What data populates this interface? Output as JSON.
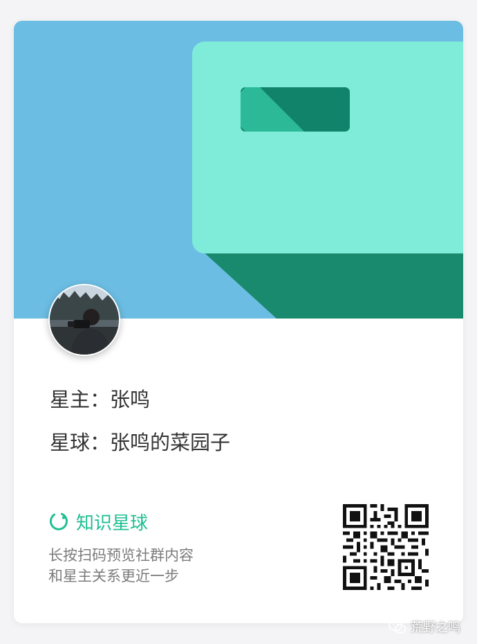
{
  "card": {
    "owner_label": "星主：",
    "owner_name": "张鸣",
    "planet_label": "星球：",
    "planet_name": "张鸣的菜园子",
    "brand_name": "知识星球",
    "hint_line1": "长按扫码预览社群内容",
    "hint_line2": "和星主关系更近一步",
    "brand_icon": "planet-ring-icon",
    "qr_icon": "qr-code"
  },
  "watermark": {
    "text": "荒野之鸣",
    "icon": "wechat-icon"
  },
  "colors": {
    "banner_blue": "#6cbde3",
    "panel_mint": "#7fecd9",
    "shadow_green": "#1a8a6e",
    "slot_dark": "#11836a",
    "slot_light": "#2cb998",
    "brand_green": "#1fbf92"
  }
}
